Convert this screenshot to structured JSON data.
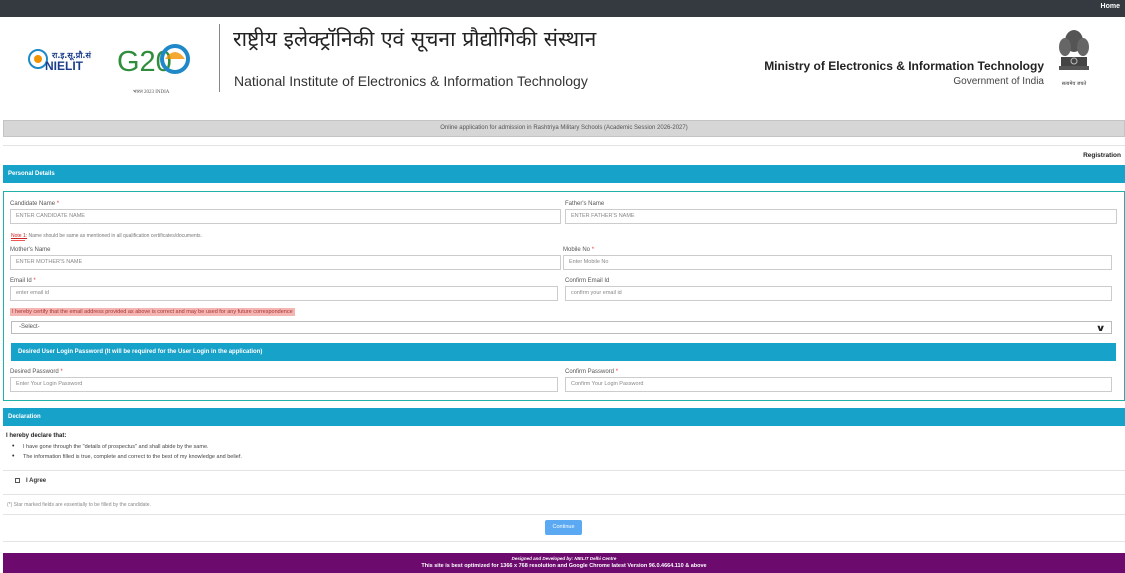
{
  "topbar": {
    "home_label": "Home"
  },
  "header": {
    "logo": {
      "hindi_abbr": "रा.इ.सू.प्रौ.सं",
      "brand": "NIELIT",
      "g20": "G20",
      "g20_tagline": "भारत 2023 INDIA"
    },
    "institute_hindi": "राष्ट्रीय इलेक्ट्रॉनिकी एवं सूचना प्रौद्योगिकी संस्थान",
    "institute_english": "National Institute of Electronics & Information Technology",
    "ministry": "Ministry of Electronics & Information Technology",
    "government": "Government of India",
    "emblem_motto": "सत्यमेव जयते"
  },
  "banner": {
    "text": "Online application for admission in Rashtriya Military Schools (Academic Session 2026-2027)"
  },
  "registration_label": "Registration",
  "personal_details": {
    "heading": "Personal Details",
    "candidate_name": {
      "label": "Candidate Name",
      "required_mark": "*",
      "placeholder": "ENTER CANDIDATE NAME"
    },
    "fathers_name": {
      "label": "Father's Name",
      "placeholder": "ENTER FATHER'S NAME"
    },
    "note": {
      "prefix": "Note 1:",
      "text": " Name should be same as mentioned in all qualification certificates/documents."
    },
    "mothers_name": {
      "label": "Mother's Name",
      "placeholder": "ENTER MOTHER'S NAME"
    },
    "mobile": {
      "label": "Mobile No",
      "required_mark": "*",
      "placeholder": "Enter Mobile No"
    },
    "email": {
      "label": "Email Id",
      "required_mark": "*",
      "placeholder": "enter email id"
    },
    "confirm_email": {
      "label": "Confirm Email Id",
      "placeholder": "confirm your email id"
    },
    "certify_text": "I hereby certify that the email address provided as above is correct and may be used for any future correspondence",
    "select": {
      "value": "-Select-"
    },
    "password_heading": "Desired User Login Password (It will be required for the User Login in the application)",
    "password": {
      "label": "Desired Password",
      "required_mark": "*",
      "placeholder": "Enter Your Login Password"
    },
    "confirm_password": {
      "label": "Confirm Password",
      "required_mark": "*",
      "placeholder": "Confirm Your Login Password"
    }
  },
  "declaration": {
    "heading": "Declaration",
    "title": "I hereby declare that:",
    "items": [
      "I have gone through the \"details of prospectus\" and shall abide by the same.",
      "The information filled is true, complete and correct to the best of my knowledge and belief."
    ],
    "agree_label": "I Agree"
  },
  "star_note": "(*) Star marked fields are essentially to be filled by the candidate.",
  "continue_label": "Continue",
  "footer": {
    "designed_by": "Designed and Developed by: NIELIT Delhi Centre",
    "optimized": "This site is best optimized for 1366 x 768 resolution and Google Chrome latest Version 96.0.4664.110 & above"
  },
  "colors": {
    "section_header": "#17a2c9",
    "panel_border": "#20b2aa",
    "footer": "#6c0a6e",
    "topbar": "#343a40",
    "continue_button": "#5aa9f2"
  }
}
